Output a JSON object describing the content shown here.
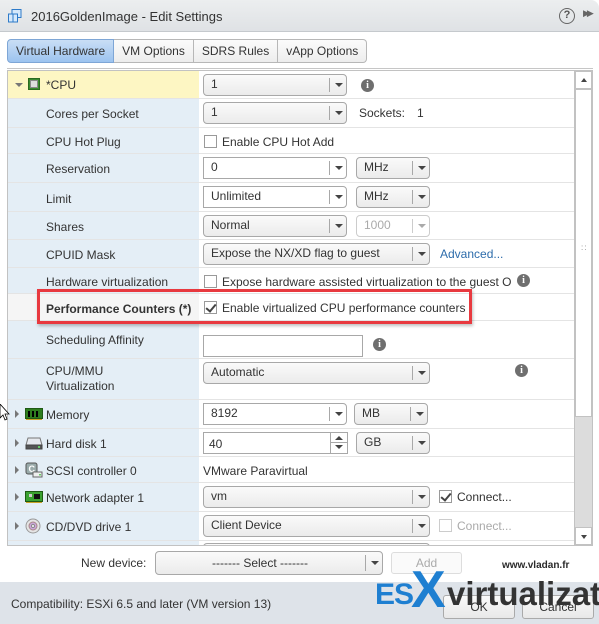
{
  "window": {
    "title": "2016GoldenImage - Edit Settings",
    "icons": [
      "vm-icon",
      "help-icon",
      "expand-icon"
    ]
  },
  "tabs": [
    {
      "label": "Virtual Hardware",
      "active": true
    },
    {
      "label": "VM Options",
      "active": false
    },
    {
      "label": "SDRS Rules",
      "active": false
    },
    {
      "label": "vApp Options",
      "active": false
    }
  ],
  "cpu": {
    "label": "*CPU",
    "value": "1",
    "cores_per_socket": {
      "label": "Cores per Socket",
      "value": "1",
      "sockets_label": "Sockets:",
      "sockets_value": "1"
    },
    "hot_plug": {
      "label": "CPU Hot Plug",
      "checkbox_label": "Enable CPU Hot Add",
      "checked": false
    },
    "reservation": {
      "label": "Reservation",
      "value": "0",
      "unit": "MHz"
    },
    "limit": {
      "label": "Limit",
      "value": "Unlimited",
      "unit": "MHz"
    },
    "shares": {
      "label": "Shares",
      "value": "Normal",
      "amount": "1000"
    },
    "cpuid_mask": {
      "label": "CPUID Mask",
      "value": "Expose the NX/XD flag to guest",
      "link": "Advanced..."
    },
    "hw_virt": {
      "label": "Hardware virtualization",
      "checkbox_label": "Expose hardware assisted virtualization to the guest O",
      "checked": false
    },
    "perf_counters": {
      "label": "Performance Counters (*)",
      "checkbox_label": "Enable virtualized CPU performance counters",
      "checked": true
    },
    "sched_affinity": {
      "label": "Scheduling Affinity",
      "value": ""
    },
    "mmu": {
      "label_line1": "CPU/MMU",
      "label_line2": "Virtualization",
      "value": "Automatic"
    }
  },
  "devices": [
    {
      "label": "Memory",
      "icon": "memory-icon",
      "value": "8192",
      "unit": "MB"
    },
    {
      "label": "Hard disk 1",
      "icon": "hard-disk-icon",
      "value": "40",
      "unit": "GB"
    },
    {
      "label": "SCSI controller 0",
      "icon": "scsi-controller-icon",
      "value": "VMware Paravirtual"
    },
    {
      "label": "Network adapter 1",
      "icon": "network-adapter-icon",
      "value": "vm",
      "connect_label": "Connect...",
      "connected": true
    },
    {
      "label": "CD/DVD drive 1",
      "icon": "cd-dvd-icon",
      "value": "Client Device",
      "connect_label": "Connect...",
      "connected": false
    }
  ],
  "new_device": {
    "label": "New device:",
    "value": "------- Select -------",
    "add_label": "Add"
  },
  "footer": {
    "compatibility": "Compatibility: ESXi 6.5 and later (VM version 13)",
    "ok_label": "OK",
    "cancel_label": "Cancel"
  },
  "watermark": {
    "url": "www.vladan.fr",
    "es": "ES",
    "x": "X",
    "virtualization": "virtualization"
  }
}
